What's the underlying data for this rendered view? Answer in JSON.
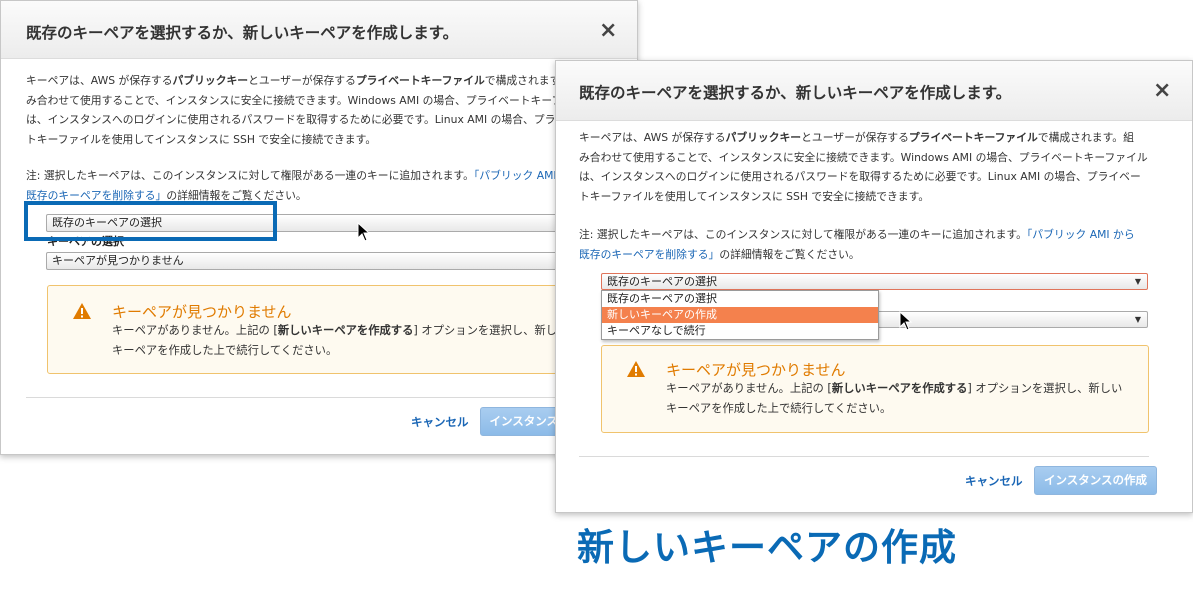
{
  "dialog": {
    "title": "既存のキーペアを選択するか、新しいキーペアを作成します。",
    "close_glyph": "×",
    "intro_lines": [
      [
        "キーペアは、AWS が保存する",
        "パブリックキー",
        "とユーザーが保存する",
        "プライベートキーファイル",
        "で構成されます。組"
      ],
      [
        "み合わせて使用することで、インスタンスに安全に接続できます。Windows AMI の場合、プライベートキーファイル"
      ],
      [
        "は、インスタンスへのログインに使用されるパスワードを取得するために必要です。Linux AMI の場合、プライベー"
      ],
      [
        "トキーファイルを使用してインスタンスに SSH で安全に接続できます。"
      ]
    ],
    "note_line1_prefix": "注: 選択したキーペアは、このインスタンスに対して権限がある一連のキーに追加されます。",
    "note_link_part1": "「パブリック AMI から",
    "note_link_part2": "既存のキーペアを削除する」",
    "note_line2_suffix": "の詳細情報をご覧ください。",
    "select_keypair_value": "既存のキーペアの選択",
    "select_keypair_label": "キーペアの選択",
    "select_keypair_name_value": "キーペアが見つかりません",
    "dropdown_options": [
      "既存のキーペアの選択",
      "新しいキーペアの作成",
      "キーペアなしで続行"
    ],
    "dropdown_selected_index": 1,
    "warning_title": "キーペアが見つかりません",
    "warning_line1_prefix": "キーペアがありません。上記の [",
    "warning_line1_bold": "新しいキーペアを作成する",
    "warning_line1_suffix": "] オプションを選択し、新しい",
    "warning_line2": "キーペアを作成した上で続行してください。",
    "cancel_label": "キャンセル",
    "launch_label": "インスタンスの作成"
  },
  "caption": "新しいキーペアの作成",
  "colors": {
    "accent": "#0a6ab5",
    "link": "#1a66b5",
    "warning": "#e07b00",
    "selected_option": "#f4814d"
  }
}
